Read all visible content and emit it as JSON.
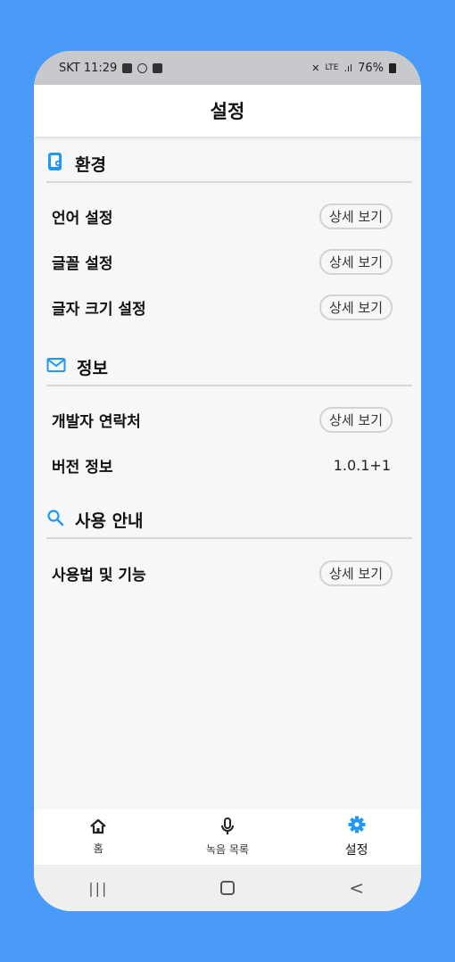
{
  "status_bar": {
    "carrier_time": "SKT 11:29",
    "signal_text": "LTE",
    "battery": "76%"
  },
  "app_bar": {
    "title": "설정"
  },
  "sections": [
    {
      "title": "환경",
      "icon": "phone-settings-icon",
      "icon_color": "#2196f3",
      "rows": [
        {
          "label": "언어 설정",
          "action": "상세 보기"
        },
        {
          "label": "글꼴 설정",
          "action": "상세 보기"
        },
        {
          "label": "글자 크기 설정",
          "action": "상세 보기"
        }
      ]
    },
    {
      "title": "정보",
      "icon": "mail-icon",
      "icon_color": "#2196f3",
      "rows": [
        {
          "label": "개발자 연락처",
          "action": "상세 보기"
        },
        {
          "label": "버전 정보",
          "value": "1.0.1+1"
        }
      ]
    },
    {
      "title": "사용 안내",
      "icon": "search-icon",
      "icon_color": "#2196f3",
      "rows": [
        {
          "label": "사용법 및 기능",
          "action": "상세 보기"
        }
      ]
    }
  ],
  "bottom_nav": [
    {
      "label": "홈",
      "icon": "home-icon"
    },
    {
      "label": "녹음 목록",
      "icon": "mic-icon"
    },
    {
      "label": "설정",
      "icon": "gear-icon",
      "active": true
    }
  ],
  "system_nav": {
    "recents": "|||",
    "home": "○",
    "back": "<"
  },
  "colors": {
    "background": "#4a9bf7",
    "accent": "#2196f3",
    "active_tab": "#2196f3"
  }
}
